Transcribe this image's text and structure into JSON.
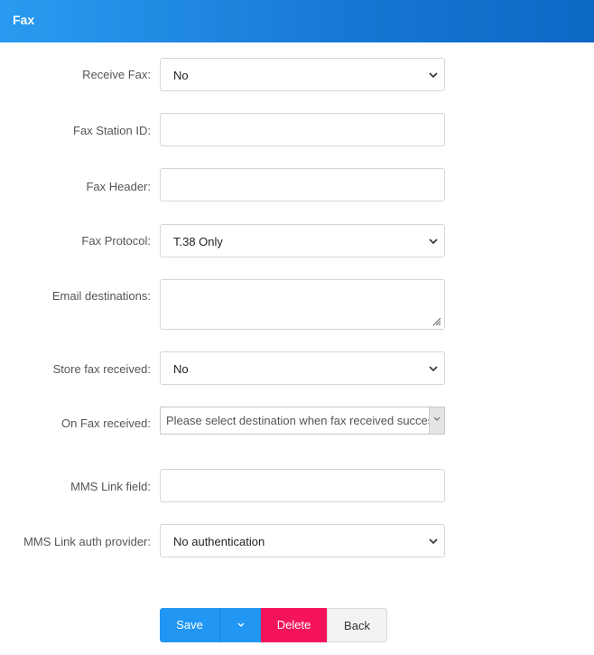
{
  "header": {
    "title": "Fax"
  },
  "form": {
    "receive_fax": {
      "label": "Receive Fax:",
      "value": "No"
    },
    "fax_station_id": {
      "label": "Fax Station ID:",
      "value": ""
    },
    "fax_header": {
      "label": "Fax Header:",
      "value": ""
    },
    "fax_protocol": {
      "label": "Fax Protocol:",
      "value": "T.38 Only"
    },
    "email_destinations": {
      "label": "Email destinations:",
      "value": ""
    },
    "store_fax_received": {
      "label": "Store fax received:",
      "value": "No"
    },
    "on_fax_received": {
      "label": "On Fax received:",
      "placeholder": "Please select destination when fax received successfully"
    },
    "mms_link_field": {
      "label": "MMS Link field:",
      "value": ""
    },
    "mms_link_auth_provider": {
      "label": "MMS Link auth provider:",
      "value": "No authentication"
    }
  },
  "buttons": {
    "save": "Save",
    "delete": "Delete",
    "back": "Back"
  }
}
